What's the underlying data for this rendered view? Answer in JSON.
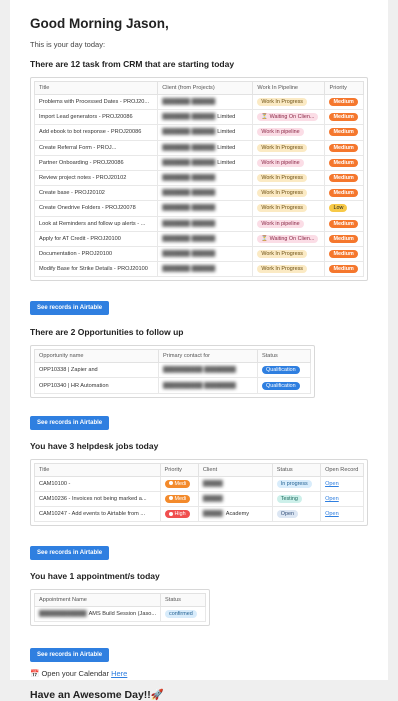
{
  "greeting": "Good Morning Jason,",
  "subtitle": "This is your day today:",
  "tasks": {
    "heading_pre": "There are ",
    "heading_count": "12",
    "heading_post": " task from CRM that are starting today",
    "columns": [
      "Title",
      "Client (from Projects)",
      "Work In Pipeline",
      "Priority"
    ],
    "rows": [
      {
        "title": "Problems with Processed Dates - PROJ20...",
        "client": "",
        "pipeline": "Work In Progress",
        "pipeline_style": "beige",
        "priority": "Medium",
        "priority_style": "orange"
      },
      {
        "title": "Import Lead generators - PROJ20086",
        "client": "Limited",
        "pipeline": "⏳ Waiting On Clien...",
        "pipeline_style": "pink",
        "priority": "Medium",
        "priority_style": "orange"
      },
      {
        "title": "Add ebook to bot response - PROJ20086",
        "client": "Limited",
        "pipeline": "Work in pipeline",
        "pipeline_style": "pink",
        "priority": "Medium",
        "priority_style": "orange"
      },
      {
        "title": "Create Referral Form - PROJ...",
        "client": "Limited",
        "pipeline": "Work In Progress",
        "pipeline_style": "beige",
        "priority": "Medium",
        "priority_style": "orange"
      },
      {
        "title": "Partner Onboarding - PROJ20086",
        "client": "Limited",
        "pipeline": "Work in pipeline",
        "pipeline_style": "pink",
        "priority": "Medium",
        "priority_style": "orange"
      },
      {
        "title": "Review project notes - PROJ20102",
        "client": "",
        "pipeline": "Work In Progress",
        "pipeline_style": "beige",
        "priority": "Medium",
        "priority_style": "orange"
      },
      {
        "title": "Create base - PROJ20102",
        "client": "",
        "pipeline": "Work In Progress",
        "pipeline_style": "beige",
        "priority": "Medium",
        "priority_style": "orange"
      },
      {
        "title": "Create Onedrive Folders - PROJ20078",
        "client": "",
        "pipeline": "Work In Progress",
        "pipeline_style": "beige",
        "priority": "Low",
        "priority_style": "yellow"
      },
      {
        "title": "Look at Reminders and follow up alerts - ...",
        "client": "",
        "pipeline": "Work in pipeline",
        "pipeline_style": "pink",
        "priority": "Medium",
        "priority_style": "orange"
      },
      {
        "title": "Apply for AT Credit - PROJ20100",
        "client": "",
        "pipeline": "⏳ Waiting On Clien...",
        "pipeline_style": "pink",
        "priority": "Medium",
        "priority_style": "orange"
      },
      {
        "title": "Documentation - PROJ20100",
        "client": "",
        "pipeline": "Work In Progress",
        "pipeline_style": "beige",
        "priority": "Medium",
        "priority_style": "orange"
      },
      {
        "title": "Modify Base for Strike Details - PROJ20100",
        "client": "",
        "pipeline": "Work In Progress",
        "pipeline_style": "beige",
        "priority": "Medium",
        "priority_style": "orange"
      }
    ],
    "button": "See records in Airtable"
  },
  "opps": {
    "heading": "There are 2 Opportunities to follow up",
    "columns": [
      "Opportunity name",
      "Primary contact for",
      "Status"
    ],
    "rows": [
      {
        "name": "OPP10338 | Zapier and",
        "contact": "",
        "status": "Qualification"
      },
      {
        "name": "OPP10340 | HR Automation",
        "contact": "",
        "status": "Qualification"
      }
    ],
    "button": "See records in Airtable"
  },
  "helpdesk": {
    "heading": "You have 3 helpdesk jobs today",
    "columns": [
      "Title",
      "Priority",
      "Client",
      "Status",
      "Open Record"
    ],
    "rows": [
      {
        "title": "CAM10100 -",
        "priority": "Medi",
        "priority_style": "orange2",
        "client": "",
        "status": "In progress",
        "status_style": "lightblue",
        "open": "Open"
      },
      {
        "title": "CAM10236 - Invoices not being marked a...",
        "priority": "Medi",
        "priority_style": "orange2",
        "client": "",
        "status": "Testing",
        "status_style": "teal",
        "open": "Open"
      },
      {
        "title": "CAM10247 - Add events to Airtable from ...",
        "priority": "High",
        "priority_style": "red",
        "client": "Academy",
        "status": "Open",
        "status_style": "grayblue",
        "open": "Open"
      }
    ],
    "button": "See records in Airtable"
  },
  "appointments": {
    "heading": "You have 1 appointment/s today",
    "columns": [
      "Appointment Name",
      "Status"
    ],
    "rows": [
      {
        "name": "AMS Build Session (Jaso...",
        "status": "confirmed"
      }
    ],
    "button": "See records in Airtable"
  },
  "calendar": {
    "icon": "calendar-icon",
    "text": "Open your Calendar",
    "link": "Here"
  },
  "signoff": "Have an Awesome Day!!🚀"
}
